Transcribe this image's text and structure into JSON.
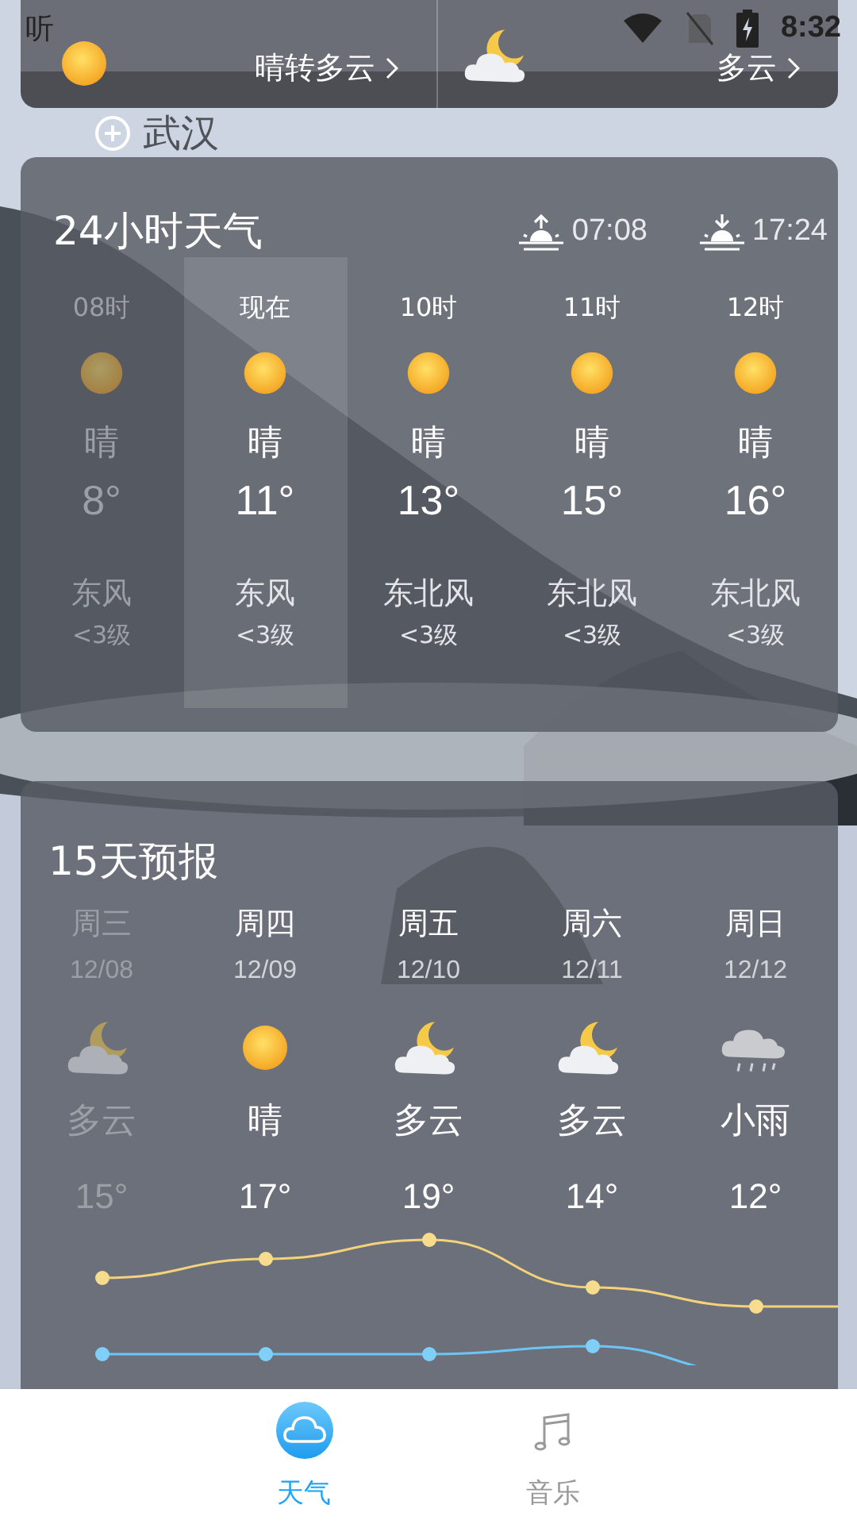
{
  "status_bar": {
    "carrier": "听",
    "time": "8:32"
  },
  "summary": [
    {
      "kind": "sun",
      "text": "晴转多云"
    },
    {
      "kind": "cloud-moon",
      "text": "多云"
    }
  ],
  "city": {
    "name": "武汉"
  },
  "hourly": {
    "title": "24小时天气",
    "sunrise": "07:08",
    "sunset": "17:24",
    "hours": [
      {
        "time": "08时",
        "kind": "sun",
        "condition": "晴",
        "temp": "8°",
        "wind": "东风",
        "wind_level": "<3级",
        "past": true,
        "current": false
      },
      {
        "time": "现在",
        "kind": "sun",
        "condition": "晴",
        "temp": "11°",
        "wind": "东风",
        "wind_level": "<3级",
        "past": false,
        "current": true
      },
      {
        "time": "10时",
        "kind": "sun",
        "condition": "晴",
        "temp": "13°",
        "wind": "东北风",
        "wind_level": "<3级",
        "past": false,
        "current": false
      },
      {
        "time": "11时",
        "kind": "sun",
        "condition": "晴",
        "temp": "15°",
        "wind": "东北风",
        "wind_level": "<3级",
        "past": false,
        "current": false
      },
      {
        "time": "12时",
        "kind": "sun",
        "condition": "晴",
        "temp": "16°",
        "wind": "东北风",
        "wind_level": "<3级",
        "past": false,
        "current": false
      }
    ]
  },
  "forecast": {
    "title": "15天预报",
    "days": [
      {
        "day": "周三",
        "date": "12/08",
        "kind": "cloud-moon",
        "condition": "多云",
        "temp": "15°",
        "past": true
      },
      {
        "day": "周四",
        "date": "12/09",
        "kind": "sun",
        "condition": "晴",
        "temp": "17°",
        "past": false
      },
      {
        "day": "周五",
        "date": "12/10",
        "kind": "cloud-moon",
        "condition": "多云",
        "temp": "19°",
        "past": false
      },
      {
        "day": "周六",
        "date": "12/11",
        "kind": "cloud-moon",
        "condition": "多云",
        "temp": "14°",
        "past": false
      },
      {
        "day": "周日",
        "date": "12/12",
        "kind": "rain",
        "condition": "小雨",
        "temp": "12°",
        "past": false
      }
    ]
  },
  "nav": [
    {
      "kind": "weather",
      "label": "天气",
      "selected": true
    },
    {
      "kind": "music",
      "label": "音乐",
      "selected": false
    }
  ]
}
